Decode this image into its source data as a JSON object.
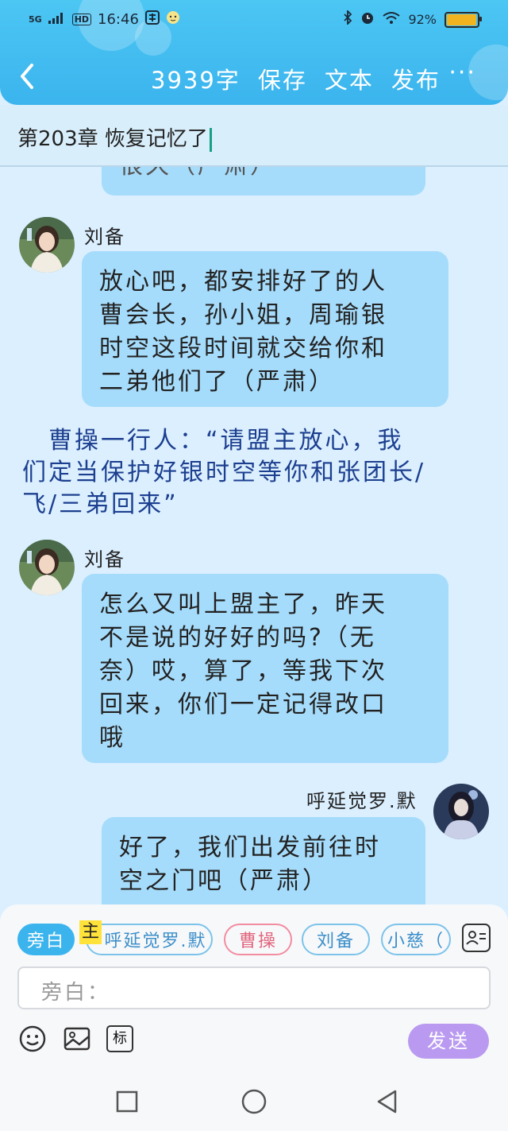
{
  "status_bar": {
    "network": "5G",
    "hd": "HD",
    "time": "16:46",
    "battery": "92%"
  },
  "header": {
    "word_count": "3939字",
    "save": "保存",
    "text": "文本",
    "publish": "发布",
    "more": "···"
  },
  "chapter_title": "第203章 恢复记忆了",
  "chat": {
    "partial_bubble": "很久（严肃）",
    "messages": [
      {
        "sender": "刘备",
        "lines": [
          "放心吧，都安排好了的人",
          "曹会长，孙小姐，周瑜银",
          "时空这段时间就交给你和",
          "二弟他们了（严肃）"
        ]
      },
      {
        "sender": "刘备",
        "lines": [
          "怎么又叫上盟主了，昨天",
          "不是说的好好的吗?（无",
          "奈）哎，算了，等我下次",
          "回来，你们一定记得改口",
          "哦"
        ]
      },
      {
        "sender": "呼延觉罗.默",
        "lines": [
          "好了，我们出发前往时",
          "空之门吧（严肃）"
        ]
      }
    ],
    "narration_lines": [
      "　曹操一行人：“请盟主放心，我",
      "们定当保护好银时空等你和张团长/",
      "飞/三弟回来”"
    ]
  },
  "character_bar": {
    "chips": [
      "旁白",
      "呼延觉罗.默",
      "曹操",
      "刘备",
      "小慈（"
    ],
    "main_tag": "主"
  },
  "input": {
    "placeholder": "旁白："
  },
  "tools": {
    "tag_label": "标",
    "send": "发送"
  },
  "colors": {
    "header": "#3bb4ee",
    "bubble": "#a6dcfb",
    "narration": "#1c3f8f",
    "send": "#b99af0"
  }
}
